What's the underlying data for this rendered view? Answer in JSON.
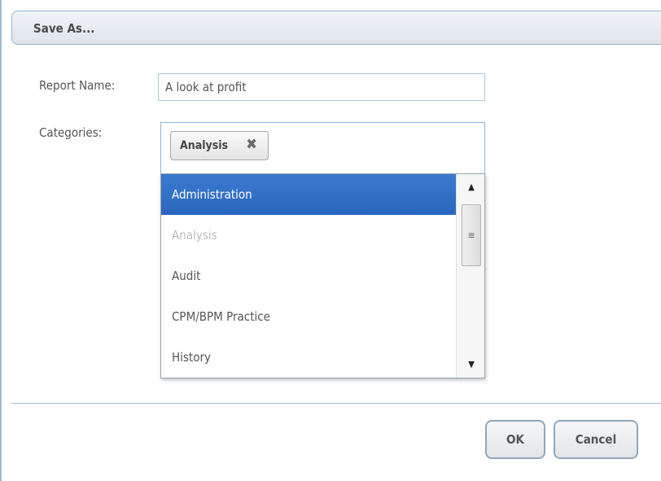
{
  "dialog": {
    "title": "Save As..."
  },
  "form": {
    "report_name_label": "Report Name:",
    "report_name_value": "A look at profit",
    "categories_label": "Categories:",
    "selected_chips": [
      {
        "label": "Analysis",
        "remove_icon": "close-icon"
      }
    ]
  },
  "dropdown": {
    "options": [
      {
        "label": "Administration",
        "state": "highlighted"
      },
      {
        "label": "Analysis",
        "state": "disabled"
      },
      {
        "label": "Audit",
        "state": "normal"
      },
      {
        "label": "CPM/BPM Practice",
        "state": "normal"
      },
      {
        "label": "History",
        "state": "normal"
      }
    ],
    "scrollbar": {
      "up_icon": "▲",
      "down_icon": "▼",
      "grip_icon": "≡"
    }
  },
  "buttons": {
    "ok": "OK",
    "cancel": "Cancel"
  },
  "colors": {
    "highlight": "#3a7bd0",
    "border_accent": "#9bbcd6",
    "disabled_text": "#bcbcbc"
  }
}
